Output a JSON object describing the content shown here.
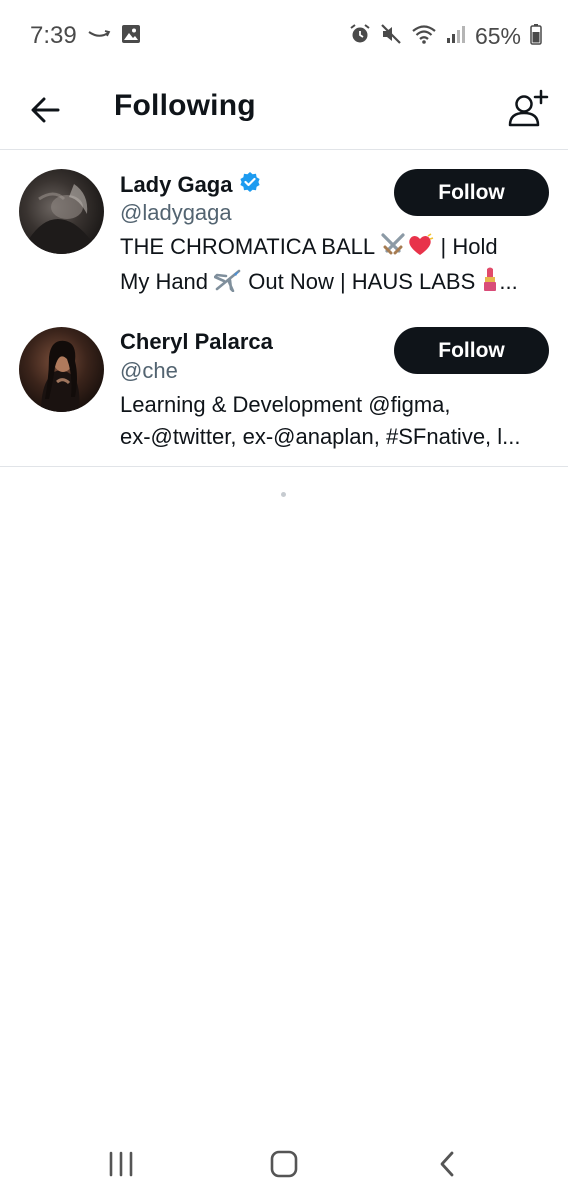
{
  "status_bar": {
    "time": "7:39",
    "battery_percent": "65%",
    "icons": [
      "amazon-smile-icon",
      "gallery-icon",
      "alarm-icon",
      "mute-icon",
      "wifi-icon",
      "signal-icon",
      "battery-icon"
    ]
  },
  "header": {
    "title": "Following",
    "back_icon": "arrow-left-icon",
    "add_user_icon": "add-user-icon"
  },
  "users": [
    {
      "name": "Lady Gaga",
      "verified": true,
      "handle": "@ladygaga",
      "bio_line_1": "THE CHROMATICA BALL ⚔️💓 | Hold",
      "bio_line_1_text_a": "THE CHROMATICA BALL ",
      "bio_line_1_text_b": " | Hold",
      "bio_line_2_text_a": "My Hand ",
      "bio_line_2_text_b": " Out Now | HAUS LABS ",
      "bio_line_2_text_c": "...",
      "follow_label": "Follow"
    },
    {
      "name": "Cheryl Palarca",
      "verified": false,
      "handle": "@che",
      "bio_line_1": "Learning & Development @figma,",
      "bio_line_2": "ex-@twitter, ex-@anaplan, #SFnative, l...",
      "follow_label": "Follow"
    }
  ],
  "colors": {
    "follow_button_bg": "#0f1419",
    "handle": "#536471",
    "verified_badge": "#1d9bf0",
    "divider": "#e1e4e8"
  },
  "nav_bar": {
    "icons": [
      "recent-apps-icon",
      "home-icon",
      "back-icon"
    ]
  }
}
